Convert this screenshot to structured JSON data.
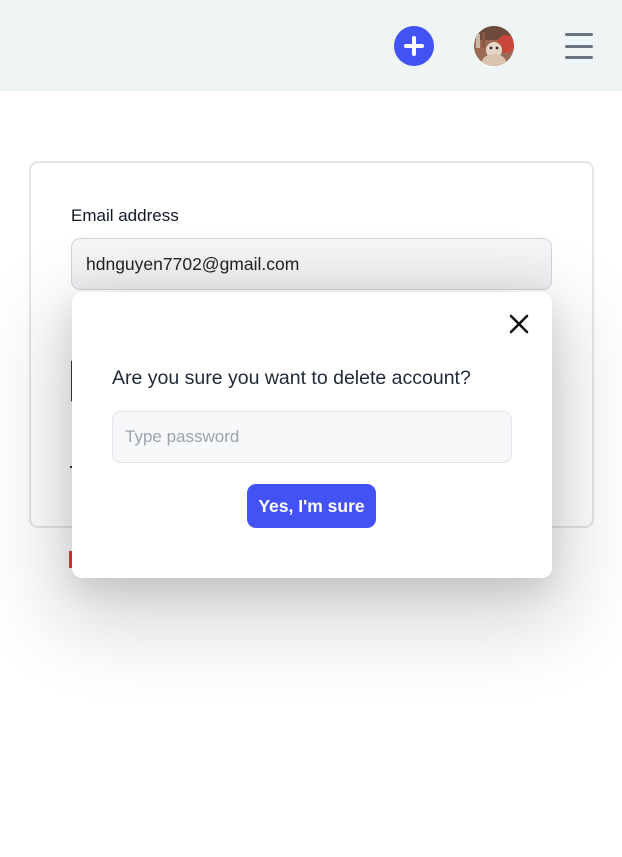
{
  "header": {
    "add_icon": "plus-circle-icon",
    "avatar_icon": "user-avatar",
    "menu_icon": "hamburger-menu-icon",
    "accent_color": "#4352f5"
  },
  "form": {
    "email_label": "Email address",
    "email_value": "hdnguyen7702@gmail.com"
  },
  "modal": {
    "question": "Are you sure you want to delete account?",
    "password_placeholder": "Type password",
    "confirm_label": "Yes, I'm sure",
    "close_icon": "close-icon"
  }
}
